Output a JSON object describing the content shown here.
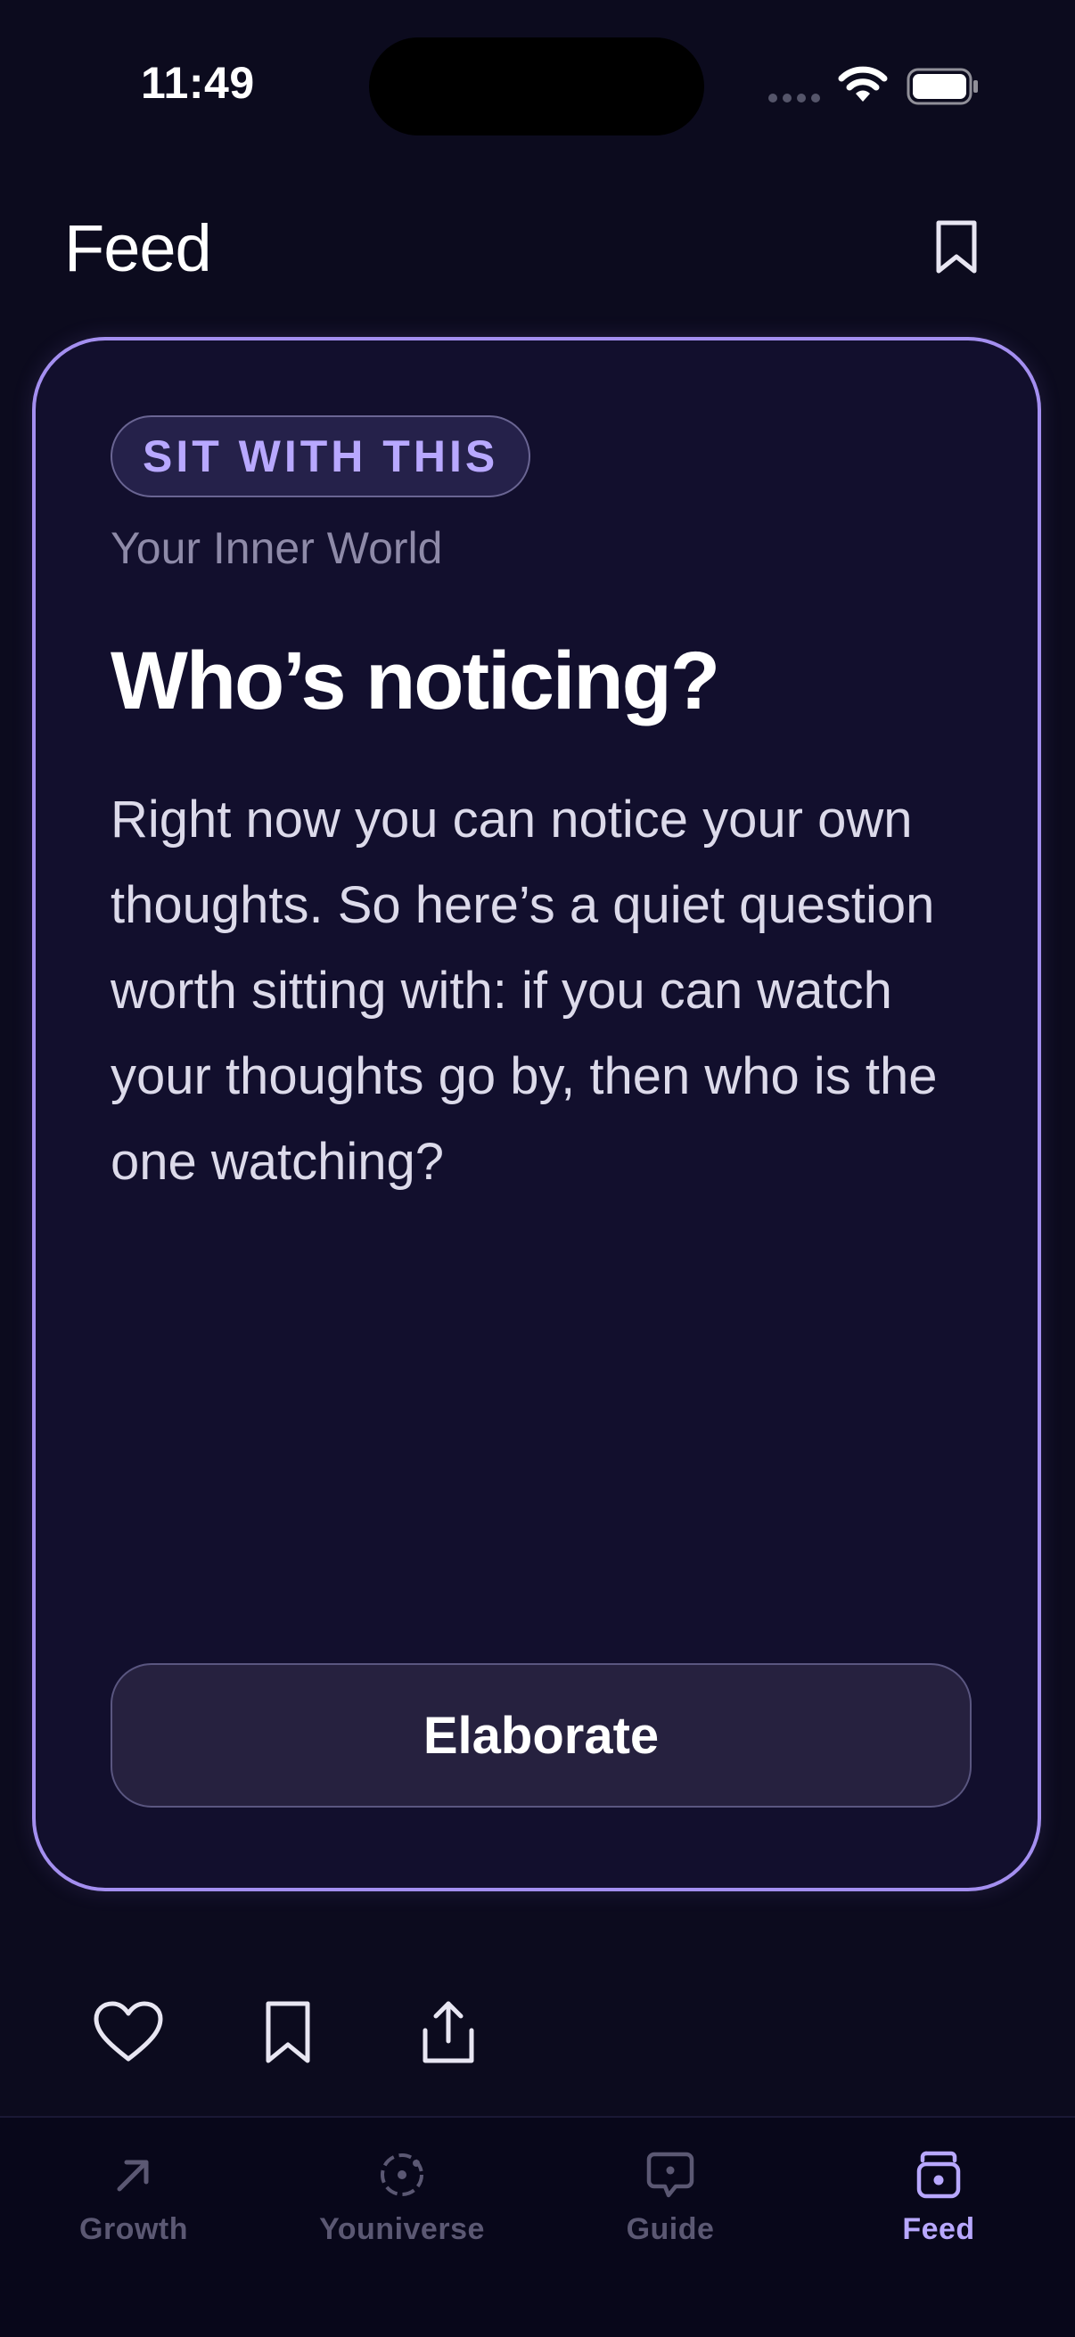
{
  "status_bar": {
    "time": "11:49"
  },
  "header": {
    "title": "Feed",
    "bookmark_icon": "bookmark-icon"
  },
  "card": {
    "badge": "SIT WITH THIS",
    "category": "Your Inner World",
    "title": "Who’s noticing?",
    "body": "Right now you can notice your own thoughts. So here’s a quiet question worth sitting with: if you can watch your thoughts go by, then who is the one watching?",
    "button_label": "Elaborate"
  },
  "actions": {
    "icons": [
      "heart-icon",
      "bookmark-icon",
      "share-icon"
    ]
  },
  "tabbar": {
    "tabs": [
      {
        "label": "Growth",
        "icon": "arrow-up-right-icon",
        "active": false
      },
      {
        "label": "Youniverse",
        "icon": "orbit-icon",
        "active": false
      },
      {
        "label": "Guide",
        "icon": "chat-bubble-icon",
        "active": false
      },
      {
        "label": "Feed",
        "icon": "feed-stack-icon",
        "active": true
      }
    ]
  },
  "colors": {
    "background": "#0c0b1e",
    "card_background": "#120f2d",
    "card_border": "#a48ff0",
    "accent": "#b8a8ff",
    "inactive_tab": "#5b5873"
  }
}
